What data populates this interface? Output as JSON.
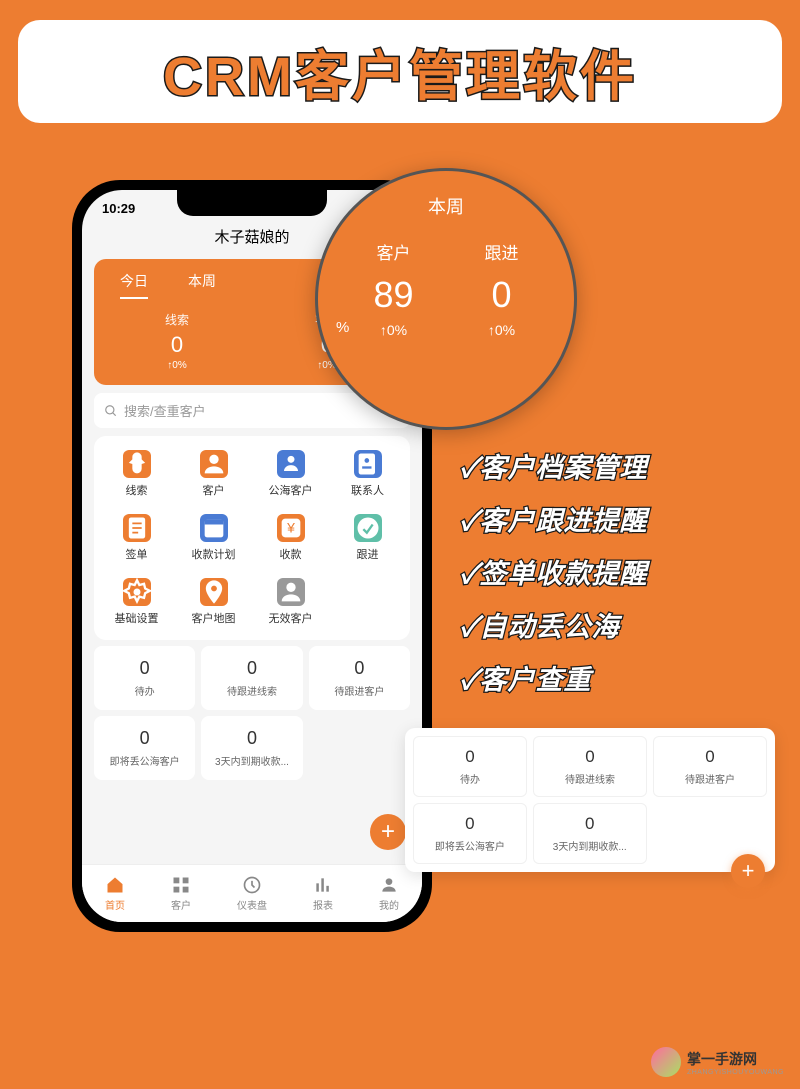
{
  "title": "CRM客户管理软件",
  "phone": {
    "time": "10:29",
    "app_title": "木子菇娘的",
    "tabs": {
      "today": "今日",
      "week": "本周"
    },
    "stats": {
      "leads": {
        "label": "线索",
        "value": "0",
        "change": "↑0%"
      },
      "customers": {
        "label": "客户",
        "value": "0",
        "change": "↑0%"
      }
    },
    "search_placeholder": "搜索/查重客户",
    "menu": [
      {
        "label": "线索",
        "color": "#ED7D31",
        "icon": "leads"
      },
      {
        "label": "客户",
        "color": "#ED7D31",
        "icon": "person"
      },
      {
        "label": "公海客户",
        "color": "#4A7BD4",
        "icon": "sea"
      },
      {
        "label": "联系人",
        "color": "#4A7BD4",
        "icon": "contact"
      },
      {
        "label": "签单",
        "color": "#ED7D31",
        "icon": "sign"
      },
      {
        "label": "收款计划",
        "color": "#4A7BD4",
        "icon": "plan"
      },
      {
        "label": "收款",
        "color": "#ED7D31",
        "icon": "payment"
      },
      {
        "label": "跟进",
        "color": "#5FBFA8",
        "icon": "follow"
      },
      {
        "label": "基础设置",
        "color": "#ED7D31",
        "icon": "settings"
      },
      {
        "label": "客户地图",
        "color": "#ED7D31",
        "icon": "map"
      },
      {
        "label": "无效客户",
        "color": "#999999",
        "icon": "invalid"
      }
    ],
    "stat_cards": [
      {
        "value": "0",
        "label": "待办"
      },
      {
        "value": "0",
        "label": "待跟进线索"
      },
      {
        "value": "0",
        "label": "待跟进客户"
      },
      {
        "value": "0",
        "label": "即将丢公海客户"
      },
      {
        "value": "0",
        "label": "3天内到期收款..."
      }
    ],
    "nav": [
      {
        "label": "首页",
        "active": true
      },
      {
        "label": "客户",
        "active": false
      },
      {
        "label": "仪表盘",
        "active": false
      },
      {
        "label": "报表",
        "active": false
      },
      {
        "label": "我的",
        "active": false
      }
    ]
  },
  "magnifier": {
    "tab": "本周",
    "pct_left": "%",
    "customers": {
      "label": "客户",
      "value": "89",
      "change": "↑0%"
    },
    "follow": {
      "label": "跟进",
      "value": "0",
      "change": "↑0%"
    }
  },
  "features": [
    "✓客户档案管理",
    "✓客户跟进提醒",
    "✓签单收款提醒",
    "✓自动丢公海",
    "✓客户查重"
  ],
  "float_stats": [
    {
      "value": "0",
      "label": "待办"
    },
    {
      "value": "0",
      "label": "待跟进线索"
    },
    {
      "value": "0",
      "label": "待跟进客户"
    },
    {
      "value": "0",
      "label": "即将丢公海客户"
    },
    {
      "value": "0",
      "label": "3天内到期收款..."
    }
  ],
  "watermark": {
    "name": "掌一手游网",
    "sub": "ZHANGYISHOUYOUWANG"
  }
}
